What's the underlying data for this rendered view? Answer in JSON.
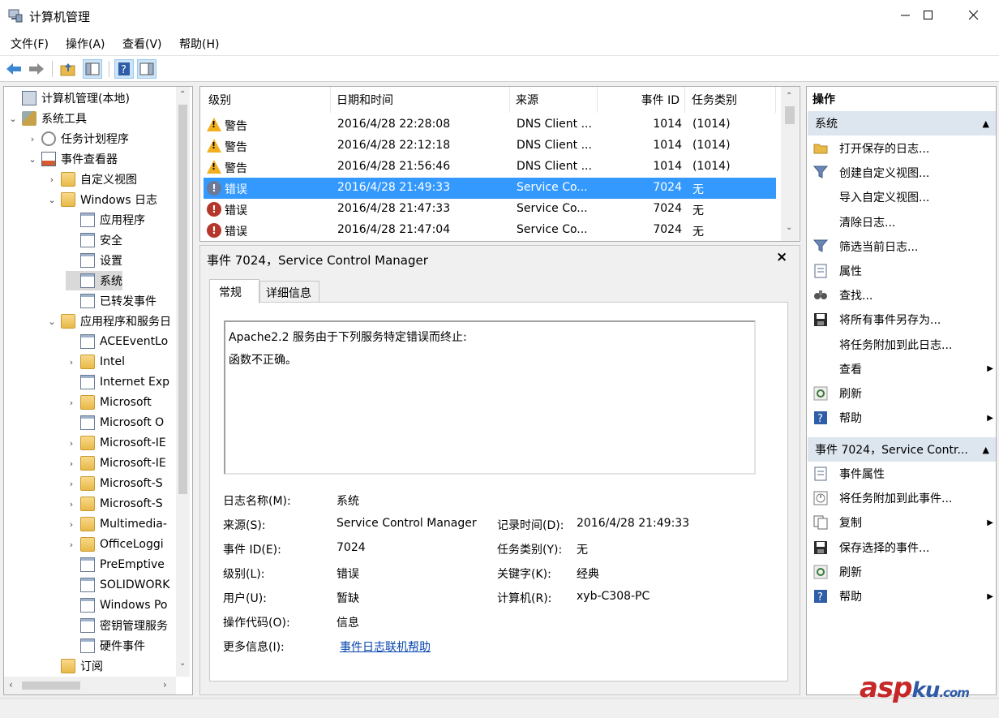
{
  "window": {
    "title": "计算机管理"
  },
  "menu": [
    "文件(F)",
    "操作(A)",
    "查看(V)",
    "帮助(H)"
  ],
  "tree": [
    {
      "label": "计算机管理(本地)",
      "icon": "computer-icon",
      "arrow": ""
    },
    {
      "label": "系统工具",
      "icon": "tools-icon",
      "arrow": "⌄"
    },
    {
      "label": "任务计划程序",
      "icon": "clock-icon",
      "arrow": "›"
    },
    {
      "label": "事件查看器",
      "icon": "event-viewer-icon",
      "arrow": "⌄"
    },
    {
      "label": "自定义视图",
      "icon": "folder-icon",
      "arrow": "›"
    },
    {
      "label": "Windows 日志",
      "icon": "folder-icon",
      "arrow": "⌄"
    },
    {
      "label": "应用程序",
      "icon": "log-icon",
      "arrow": ""
    },
    {
      "label": "安全",
      "icon": "log-icon",
      "arrow": ""
    },
    {
      "label": "设置",
      "icon": "log-icon",
      "arrow": ""
    },
    {
      "label": "系统",
      "icon": "log-icon",
      "arrow": ""
    },
    {
      "label": "已转发事件",
      "icon": "log-icon",
      "arrow": ""
    },
    {
      "label": "应用程序和服务日",
      "icon": "folder-icon",
      "arrow": "⌄"
    },
    {
      "label": "ACEEventLo",
      "icon": "log-icon",
      "arrow": ""
    },
    {
      "label": "Intel",
      "icon": "folder-icon",
      "arrow": "›"
    },
    {
      "label": "Internet Exp",
      "icon": "log-icon",
      "arrow": ""
    },
    {
      "label": "Microsoft",
      "icon": "folder-icon",
      "arrow": "›"
    },
    {
      "label": "Microsoft O",
      "icon": "log-icon",
      "arrow": ""
    },
    {
      "label": "Microsoft-IE",
      "icon": "folder-icon",
      "arrow": "›"
    },
    {
      "label": "Microsoft-IE",
      "icon": "folder-icon",
      "arrow": "›"
    },
    {
      "label": "Microsoft-S",
      "icon": "folder-icon",
      "arrow": "›"
    },
    {
      "label": "Microsoft-S",
      "icon": "folder-icon",
      "arrow": "›"
    },
    {
      "label": "Multimedia-",
      "icon": "folder-icon",
      "arrow": "›"
    },
    {
      "label": "OfficeLoggi",
      "icon": "folder-icon",
      "arrow": "›"
    },
    {
      "label": "PreEmptive",
      "icon": "log-icon",
      "arrow": ""
    },
    {
      "label": "SOLIDWORK",
      "icon": "log-icon",
      "arrow": ""
    },
    {
      "label": "Windows Po",
      "icon": "log-icon",
      "arrow": ""
    },
    {
      "label": "密钥管理服务",
      "icon": "log-icon",
      "arrow": ""
    },
    {
      "label": "硬件事件",
      "icon": "log-icon",
      "arrow": ""
    },
    {
      "label": "订阅",
      "icon": "subscription-icon",
      "arrow": ""
    }
  ],
  "events": {
    "columns": [
      "级别",
      "日期和时间",
      "来源",
      "事件 ID",
      "任务类别"
    ],
    "rows": [
      {
        "level": "警告",
        "type": "warning",
        "datetime": "2016/4/28 22:28:08",
        "source": "DNS Client ...",
        "id": "1014",
        "category": "(1014)"
      },
      {
        "level": "警告",
        "type": "warning",
        "datetime": "2016/4/28 22:12:18",
        "source": "DNS Client ...",
        "id": "1014",
        "category": "(1014)"
      },
      {
        "level": "警告",
        "type": "warning",
        "datetime": "2016/4/28 21:56:46",
        "source": "DNS Client ...",
        "id": "1014",
        "category": "(1014)"
      },
      {
        "level": "错误",
        "type": "error",
        "datetime": "2016/4/28 21:49:33",
        "source": "Service Co...",
        "id": "7024",
        "category": "无"
      },
      {
        "level": "错误",
        "type": "error",
        "datetime": "2016/4/28 21:47:33",
        "source": "Service Co...",
        "id": "7024",
        "category": "无"
      },
      {
        "level": "错误",
        "type": "error",
        "datetime": "2016/4/28 21:47:04",
        "source": "Service Co...",
        "id": "7024",
        "category": "无"
      }
    ]
  },
  "detail": {
    "title": "事件 7024，Service Control Manager",
    "tabs": [
      "常规",
      "详细信息"
    ],
    "message_line1": "Apache2.2 服务由于下列服务特定错误而终止:",
    "message_line2": "函数不正确。",
    "fields": {
      "log_name_label": "日志名称(M):",
      "log_name": "系统",
      "source_label": "来源(S):",
      "source": "Service Control Manager",
      "logged_label": "记录时间(D):",
      "logged": "2016/4/28 21:49:33",
      "event_id_label": "事件 ID(E):",
      "event_id": "7024",
      "task_label": "任务类别(Y):",
      "task": "无",
      "level_label": "级别(L):",
      "level": "错误",
      "keywords_label": "关键字(K):",
      "keywords": "经典",
      "user_label": "用户(U):",
      "user": "暂缺",
      "computer_label": "计算机(R):",
      "computer": "xyb-C308-PC",
      "opcode_label": "操作代码(O):",
      "opcode": "信息",
      "moreinfo_label": "更多信息(I):",
      "moreinfo_link": "事件日志联机帮助"
    }
  },
  "actions": {
    "title": "操作",
    "section1": "系统",
    "items1": [
      {
        "label": "打开保存的日志...",
        "icon": "open-folder-icon"
      },
      {
        "label": "创建自定义视图...",
        "icon": "filter-icon"
      },
      {
        "label": "导入自定义视图...",
        "icon": ""
      },
      {
        "label": "清除日志...",
        "icon": ""
      },
      {
        "label": "筛选当前日志...",
        "icon": "filter-icon"
      },
      {
        "label": "属性",
        "icon": "properties-icon"
      },
      {
        "label": "查找...",
        "icon": "binoculars-icon"
      },
      {
        "label": "将所有事件另存为...",
        "icon": "save-icon"
      },
      {
        "label": "将任务附加到此日志...",
        "icon": ""
      },
      {
        "label": "查看",
        "icon": "",
        "submenu": true
      },
      {
        "label": "刷新",
        "icon": "refresh-icon"
      },
      {
        "label": "帮助",
        "icon": "help-icon",
        "submenu": true
      }
    ],
    "section2": "事件 7024，Service Contr...",
    "items2": [
      {
        "label": "事件属性",
        "icon": "properties-icon"
      },
      {
        "label": "将任务附加到此事件...",
        "icon": "task-icon"
      },
      {
        "label": "复制",
        "icon": "copy-icon",
        "submenu": true
      },
      {
        "label": "保存选择的事件...",
        "icon": "save-icon"
      },
      {
        "label": "刷新",
        "icon": "refresh-icon"
      },
      {
        "label": "帮助",
        "icon": "help-icon",
        "submenu": true
      }
    ]
  },
  "watermark": "aspku.com"
}
